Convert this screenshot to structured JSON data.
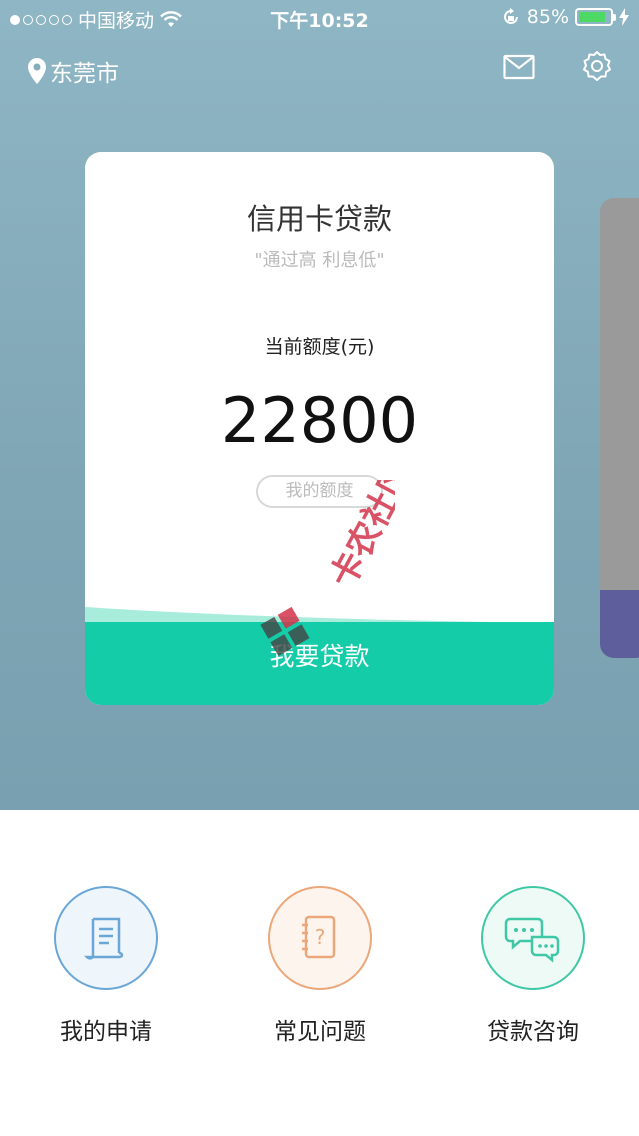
{
  "status_bar": {
    "carrier": "中国移动",
    "time": "下午10:52",
    "battery_percent": "85%",
    "battery_level": 0.85
  },
  "header": {
    "location": "东莞市",
    "icons": [
      "location-pin-icon",
      "mail-icon",
      "gear-icon"
    ]
  },
  "card": {
    "title": "信用卡贷款",
    "subtitle": "\"通过高 利息低\"",
    "limit_label": "当前额度(元)",
    "limit_value": "22800",
    "my_limit_button": "我的额度",
    "apply_button": "我要贷款",
    "accent_color": "#15cca8"
  },
  "watermark": {
    "text": "卡农社区"
  },
  "menu": {
    "items": [
      {
        "label": "我的申请",
        "icon": "scroll-icon",
        "color": "#6aa6d6"
      },
      {
        "label": "常见问题",
        "icon": "question-book-icon",
        "color": "#eba77a"
      },
      {
        "label": "贷款咨询",
        "icon": "chat-bubbles-icon",
        "color": "#3fc7a6"
      }
    ]
  }
}
